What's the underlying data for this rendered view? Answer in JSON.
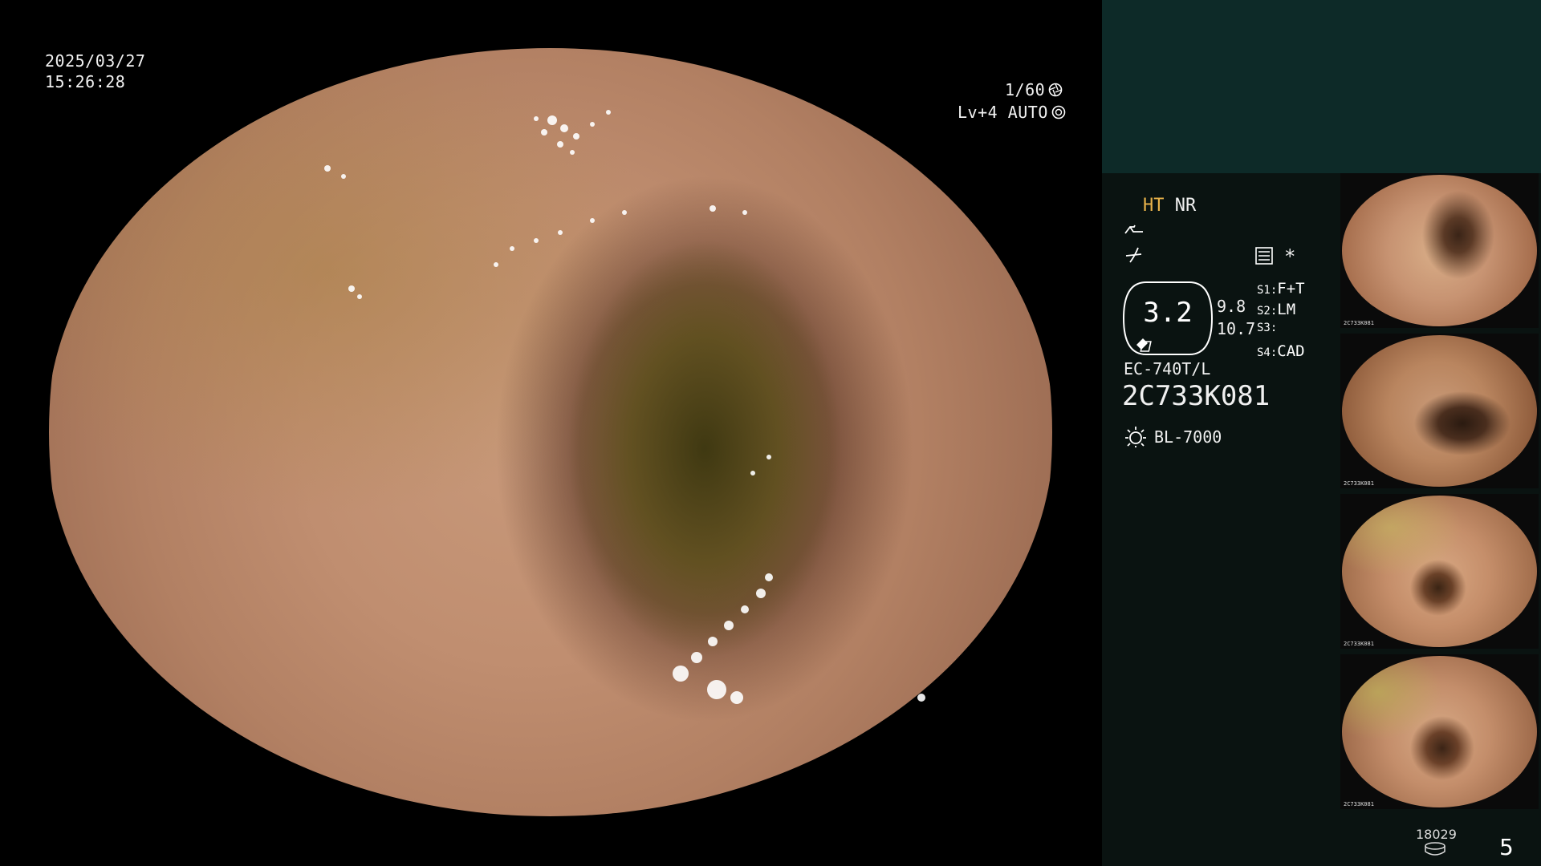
{
  "overlay": {
    "date": "2025/03/27",
    "time": "15:26:28",
    "shutter": "1/60",
    "level_mode": "Lv+4 AUTO"
  },
  "panel": {
    "mode_ht": "HT",
    "mode_nr": "NR",
    "zoom_value": "3.2",
    "value_a": "9.8",
    "value_b": "10.7",
    "switches": [
      {
        "key": "S1:",
        "value": "F+T"
      },
      {
        "key": "S2:",
        "value": "LM"
      },
      {
        "key": "S3:",
        "value": ""
      },
      {
        "key": "S4:",
        "value": "CAD"
      }
    ],
    "scope_model": "EC-740T/L",
    "scope_serial": "2C733K081",
    "light_source": "BL-7000",
    "storage_count": "18029",
    "capture_count": "5",
    "asterisk": "*"
  },
  "thumbnails": [
    {
      "label": "2C733K081"
    },
    {
      "label": "2C733K081"
    },
    {
      "label": "2C733K081"
    },
    {
      "label": "2C733K081"
    }
  ],
  "icons": {
    "shutter": "aperture-icon",
    "auto": "iris-icon",
    "lamp": "lamp-icon",
    "menu": "menu-list-icon",
    "storage": "storage-drive-icon"
  }
}
